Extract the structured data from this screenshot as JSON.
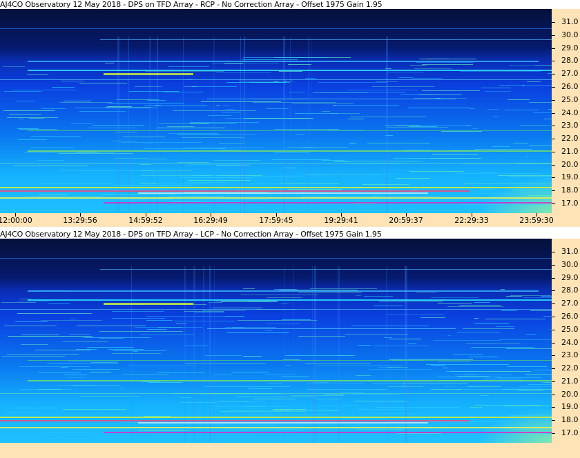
{
  "panels": [
    {
      "title": "AJ4CO Observatory 12 May 2018 - DPS on TFD Array  - RCP  -  No Correction Array  -  Offset 1975  Gain 1.95",
      "y_labels": [
        "31.0",
        "30.0",
        "29.0",
        "28.0",
        "27.0",
        "26.0",
        "25.0",
        "24.0",
        "23.0",
        "22.0",
        "21.0",
        "20.0",
        "19.0",
        "18.0",
        "17.0"
      ],
      "x_labels": [
        "12:00:00",
        "13:29:56",
        "14:59:52",
        "16:29:49",
        "17:59:45",
        "19:29:41",
        "20:59:37",
        "22:29:33",
        "23:59:30"
      ]
    },
    {
      "title": "AJ4CO Observatory 12 May 2018 - DPS on TFD Array  - LCP  -  No Correction Array  -  Offset 1975  Gain 1.95",
      "y_labels": [
        "31.0",
        "30.0",
        "29.0",
        "28.0",
        "27.0",
        "26.0",
        "25.0",
        "24.0",
        "23.0",
        "22.0",
        "21.0",
        "20.0",
        "19.0",
        "18.0",
        "17.0"
      ]
    }
  ],
  "colors": {
    "axis_bg": "#fde3b6",
    "deep": "#05103a",
    "blue": "#0a40e0",
    "cyan": "#15b4ff",
    "green": "#5ee060"
  }
}
